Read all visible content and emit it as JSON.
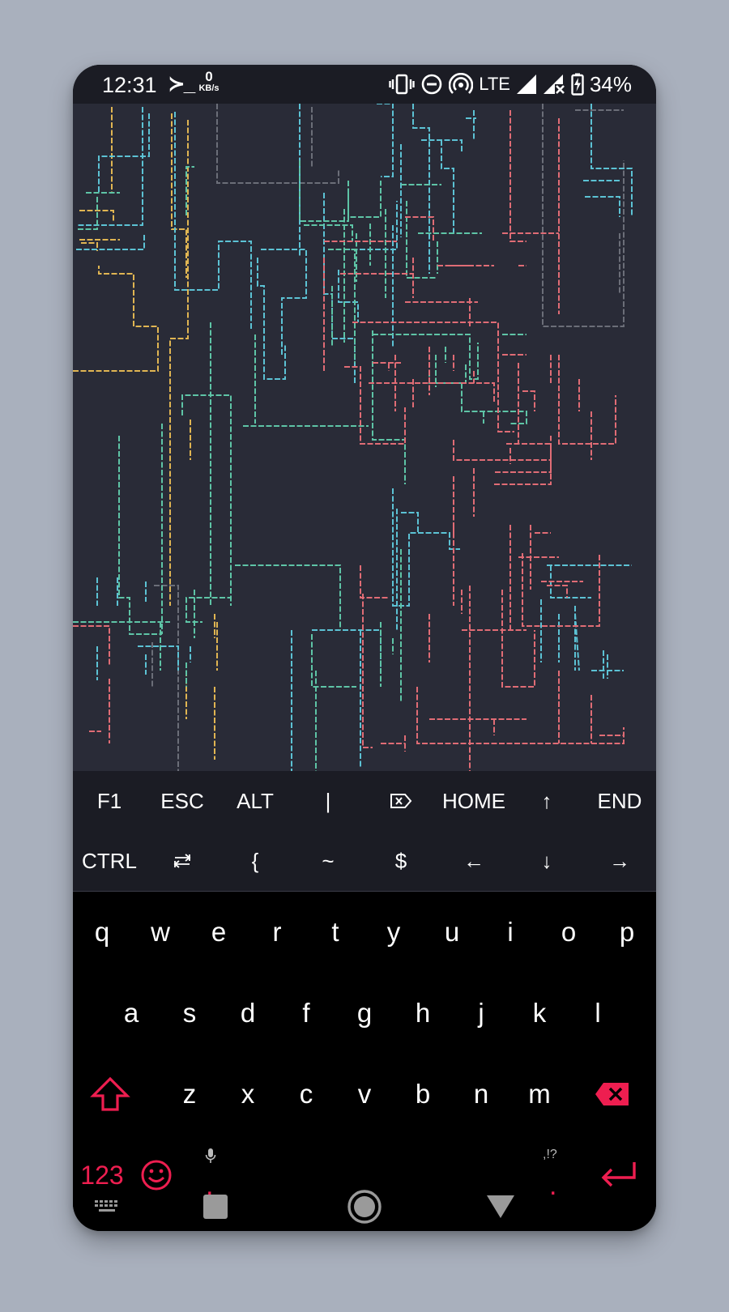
{
  "status_bar": {
    "time": "12:31",
    "terminal_glyph": "≻_",
    "net_speed_value": "0",
    "net_speed_unit": "KB/s",
    "network_type": "LTE",
    "battery_percent": "34%",
    "icons": [
      "terminal-notification-icon",
      "vibrate-icon",
      "do-not-disturb-icon",
      "hotspot-icon",
      "signal-icon",
      "signal-no-data-icon",
      "battery-charging-icon"
    ]
  },
  "extra_keys": {
    "row1": [
      "F1",
      "ESC",
      "ALT",
      "|",
      "⌦",
      "HOME",
      "↑",
      "END"
    ],
    "row2": [
      "CTRL",
      "⇆",
      "{",
      "~",
      "$",
      "←",
      "↓",
      "→"
    ]
  },
  "keyboard": {
    "row1": [
      "q",
      "w",
      "e",
      "r",
      "t",
      "y",
      "u",
      "i",
      "o",
      "p"
    ],
    "row2": [
      "a",
      "s",
      "d",
      "f",
      "g",
      "h",
      "j",
      "k",
      "l"
    ],
    "row3": [
      "z",
      "x",
      "c",
      "v",
      "b",
      "n",
      "m"
    ],
    "symbols_label": "123",
    "comma": ",",
    "period": ".",
    "period_hint": ",!?",
    "icons": [
      "shift-icon",
      "backspace-icon",
      "emoji-icon",
      "mic-icon",
      "enter-icon"
    ],
    "accent_color": "#ee1e50"
  },
  "nav_bar": {
    "icons": [
      "keyboard-switch-icon",
      "recents-icon",
      "home-icon",
      "back-icon"
    ]
  },
  "terminal": {
    "background": "#292b37",
    "pipe_colors": [
      "#e0b552",
      "#5cc2d4",
      "#5ec4a6",
      "#e06c75",
      "#6b6e78"
    ]
  }
}
